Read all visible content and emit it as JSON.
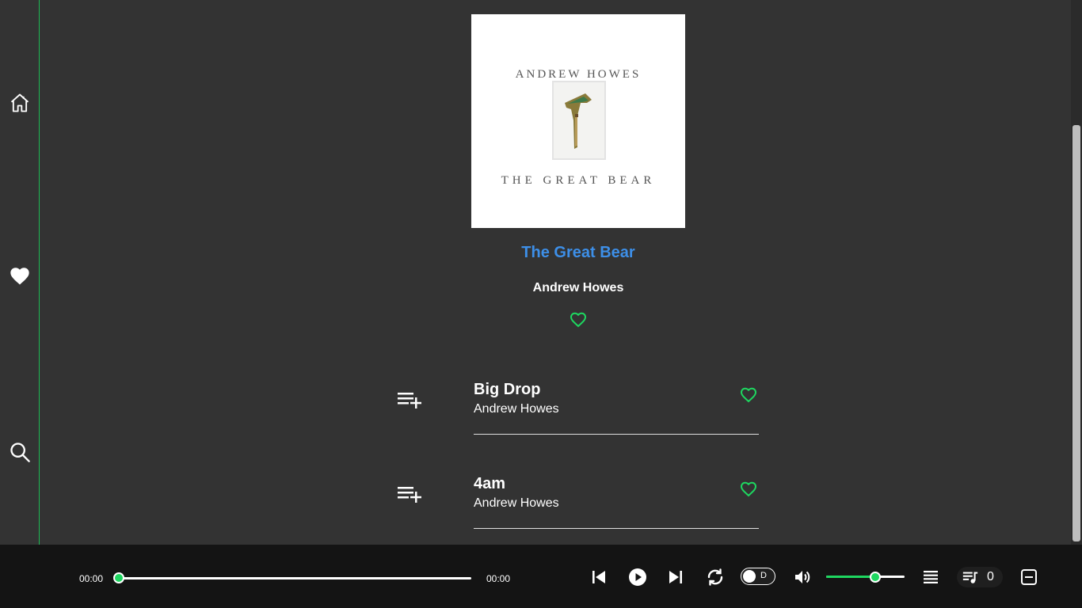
{
  "sidebar": {
    "items": [
      {
        "name": "home",
        "icon": "home-icon"
      },
      {
        "name": "favorites",
        "icon": "heart-icon"
      },
      {
        "name": "search",
        "icon": "search-icon"
      }
    ]
  },
  "album": {
    "cover_author": "ANDREW HOWES",
    "cover_title": "THE GREAT BEAR",
    "title": "The Great Bear",
    "artist": "Andrew Howes",
    "title_color": "#3d8fe8"
  },
  "tracks": [
    {
      "name": "Big Drop",
      "artist": "Andrew Howes"
    },
    {
      "name": "4am",
      "artist": "Andrew Howes"
    }
  ],
  "player": {
    "elapsed": "00:00",
    "duration": "00:00",
    "progress": 0,
    "toggle_label": "D",
    "volume": 0.63,
    "queue_count": "0",
    "accent_color": "#1ed760"
  }
}
